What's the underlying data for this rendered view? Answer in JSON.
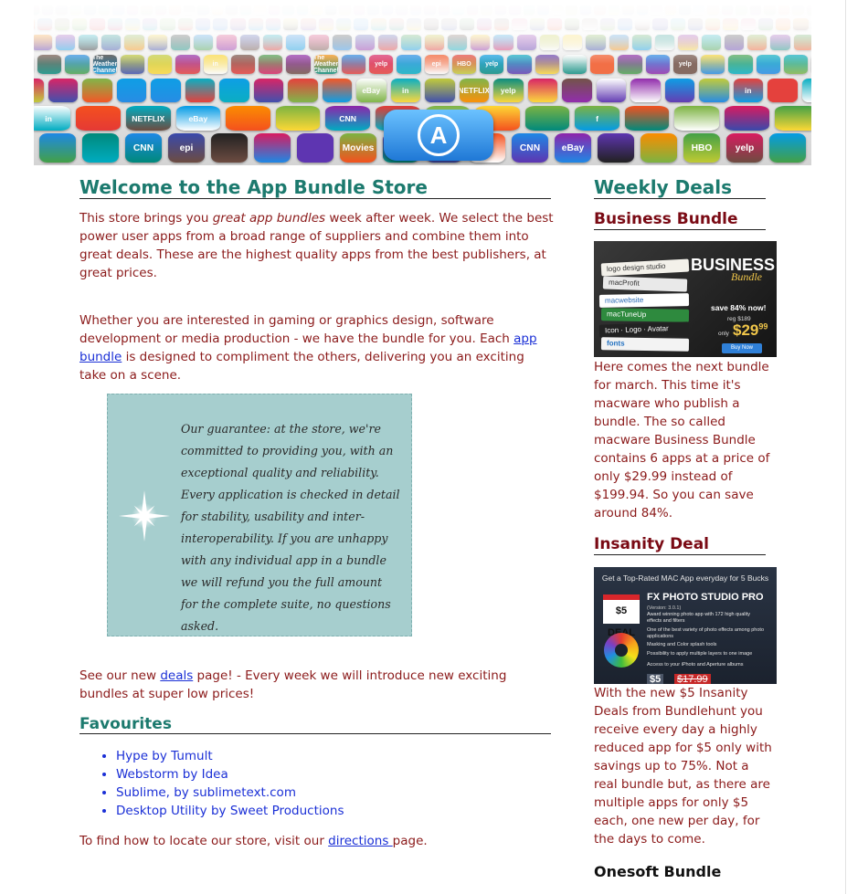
{
  "main": {
    "title": "Welcome to the App Bundle Store",
    "intro": {
      "before": "This store brings you ",
      "emphasis": "great app bundles",
      "after": " week after week. We select the best power user apps from a broad range of suppliers and combine them into great deals. These are the highest quality apps from the best publishers, at great prices."
    },
    "interest": {
      "before": "Whether you are interested in gaming or graphics design, software development or media production - we have the bundle for you. Each ",
      "link": "app bundle",
      "after": " is designed to compliment the others, delivering you an exciting take on a scene."
    },
    "guarantee": "Our guarantee: at the store, we're committed to providing you, with an exceptional quality and reliability. Every application is checked in detail for stability, usability and inter-interoperability. If you are unhappy with any individual app in a bundle we will refund you the full amount for the complete suite, no questions asked.",
    "deals_note": {
      "before": "See our new ",
      "link": "deals",
      "after": " page! - Every week we will introduce new exciting bundles at super low prices!"
    },
    "favourites": {
      "title": "Favourites",
      "items": [
        "Hype by Tumult",
        "Webstorm by Idea",
        "Sublime, by sublimetext.com",
        "Desktop Utility by Sweet Productions"
      ]
    },
    "directions": {
      "before": "To find how to locate our store, visit our ",
      "link": "directions ",
      "after": "page."
    }
  },
  "sidebar": {
    "title": "Weekly Deals",
    "business": {
      "title": "Business Bundle",
      "text": "Here comes the next bundle for march. This time it's macware who publish a bundle. The so called macware Business Bundle contains 6 apps at a price of only $29.99 instead of $199.94. So you can save around 84%.",
      "image": {
        "headline": "BUSINESS",
        "subline": "Bundle",
        "save": "save 84% now!",
        "reg": "reg $189",
        "only": "only",
        "price": "$29",
        "price_cents": "99",
        "button": "Buy Now",
        "books": [
          "logo design studio",
          "macProfit",
          "macwebsite",
          "macTuneUp",
          "Icon · Logo · Avatar",
          "fonts"
        ]
      }
    },
    "insanity": {
      "title": "Insanity Deal",
      "text": "With the new $5 Insanity Deals from Bundlehunt you receive every day a highly reduced app for $5 only with savings up to 75%. Not a real bundle but, as there are multiple apps for only $5 each, one new per day, for the days to come.",
      "image": {
        "top": "Get a Top-Rated MAC App everyday for 5 Bucks",
        "badge": "$5 DEAL",
        "name": "FX PHOTO STUDIO PRO",
        "version": "(Version: 3.0.1)",
        "desc": "Award winning photo app with 172 high quality effects and filters",
        "bullets": [
          "One of the best variety of photo effects among photo applications",
          "Masking and Color splash tools",
          "Possibility to apply multiple layers to one image",
          "Access to your iPhoto and Aperture albums"
        ],
        "price": "$5",
        "old_price": "$17.99"
      }
    },
    "onesoft": {
      "title": "Onesoft Bundle"
    }
  },
  "banner": {
    "app_labels": [
      "yelp",
      "epi",
      "eBay",
      "Movies",
      "The Weather Channel",
      "NETFLIX",
      "in",
      "f",
      "HBO",
      "CNN"
    ]
  }
}
